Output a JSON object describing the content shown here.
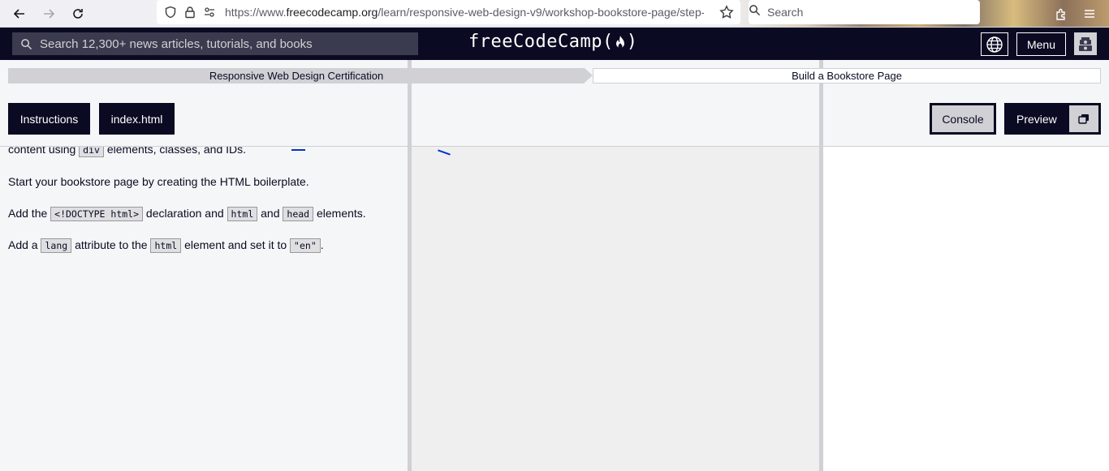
{
  "browser": {
    "url_prefix": "https://www.",
    "url_domain": "freecodecamp.org",
    "url_path": "/learn/responsive-web-design-v9/workshop-bookstore-page/step-",
    "search_placeholder": "Search"
  },
  "nav": {
    "search_placeholder": "Search 12,300+ news articles, tutorials, and books",
    "logo": "freeCodeCamp(",
    "logo_end": ")",
    "menu_label": "Menu"
  },
  "breadcrumb": {
    "certification": "Responsive Web Design Certification",
    "block": "Build a Bookstore Page"
  },
  "toolbar": {
    "instructions": "Instructions",
    "file": "index.html",
    "console": "Console",
    "preview": "Preview"
  },
  "instructions": {
    "line0_pre": "content using ",
    "line0_code": "div",
    "line0_post": " elements, classes, and IDs.",
    "line1": "Start your bookstore page by creating the HTML boilerplate.",
    "line2_a": "Add the ",
    "line2_code1": "<!DOCTYPE html>",
    "line2_b": " declaration and ",
    "line2_code2": "html",
    "line2_c": " and ",
    "line2_code3": "head",
    "line2_d": " elements.",
    "line3_a": "Add a ",
    "line3_code1": "lang",
    "line3_b": " attribute to the ",
    "line3_code2": "html",
    "line3_c": " element and set it to ",
    "line3_code3": "\"en\"",
    "line3_d": "."
  },
  "colors": {
    "nav_bg": "#0a0a23",
    "panel_bg": "#f5f6f7",
    "editor_bg": "#efefef",
    "divider": "#d0d0d5"
  },
  "icons": [
    "back-arrow-icon",
    "forward-arrow-icon",
    "reload-icon",
    "shield-icon",
    "lock-icon",
    "permissions-icon",
    "star-icon",
    "search-icon",
    "extensions-icon",
    "hamburger-icon",
    "globe-icon",
    "flame-icon",
    "avatar-icon",
    "popout-icon"
  ]
}
